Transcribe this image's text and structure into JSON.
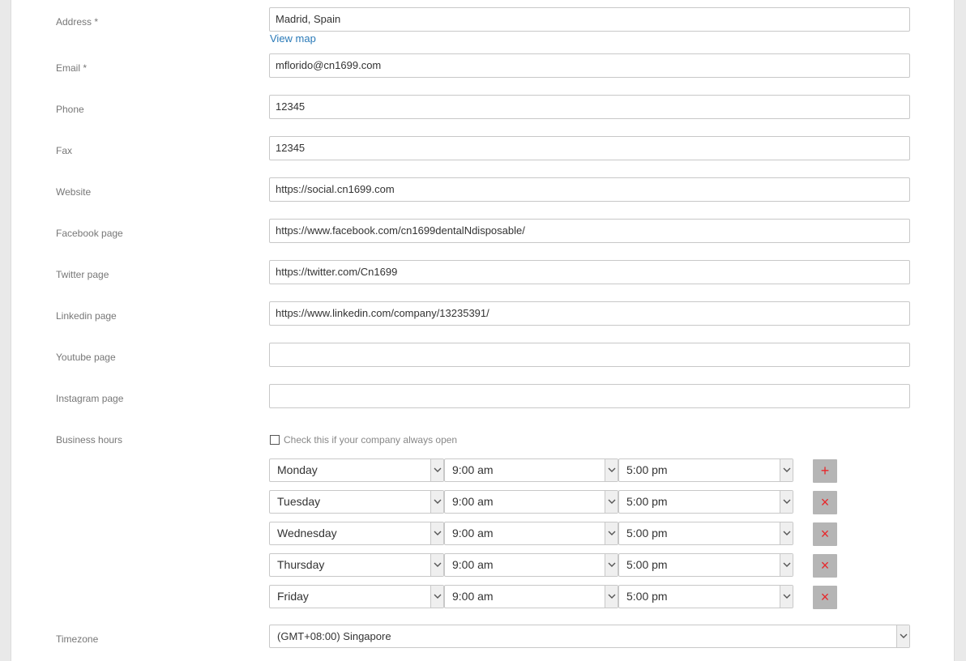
{
  "form": {
    "address": {
      "label": "Address *",
      "value": "Madrid, Spain",
      "link": "View map"
    },
    "email": {
      "label": "Email *",
      "value": "mflorido@cn1699.com"
    },
    "phone": {
      "label": "Phone",
      "value": "12345"
    },
    "fax": {
      "label": "Fax",
      "value": "12345"
    },
    "website": {
      "label": "Website",
      "value": "https://social.cn1699.com"
    },
    "facebook": {
      "label": "Facebook page",
      "value": "https://www.facebook.com/cn1699dentalNdisposable/"
    },
    "twitter": {
      "label": "Twitter page",
      "value": "https://twitter.com/Cn1699"
    },
    "linkedin": {
      "label": "Linkedin page",
      "value": "https://www.linkedin.com/company/13235391/"
    },
    "youtube": {
      "label": "Youtube page",
      "value": ""
    },
    "instagram": {
      "label": "Instagram page",
      "value": ""
    },
    "business_hours": {
      "label": "Business hours",
      "always_open_label": "Check this if your company always open",
      "always_open_checked": false,
      "rows": [
        {
          "day": "Monday",
          "open": "9:00 am",
          "close": "5:00 pm",
          "action": "+"
        },
        {
          "day": "Tuesday",
          "open": "9:00 am",
          "close": "5:00 pm",
          "action": "×"
        },
        {
          "day": "Wednesday",
          "open": "9:00 am",
          "close": "5:00 pm",
          "action": "×"
        },
        {
          "day": "Thursday",
          "open": "9:00 am",
          "close": "5:00 pm",
          "action": "×"
        },
        {
          "day": "Friday",
          "open": "9:00 am",
          "close": "5:00 pm",
          "action": "×"
        }
      ]
    },
    "timezone": {
      "label": "Timezone",
      "value": "(GMT+08:00) Singapore"
    }
  },
  "colors": {
    "link": "#2a7ab8",
    "action_icon": "#e8262a",
    "action_bg": "#b5b5b5"
  }
}
